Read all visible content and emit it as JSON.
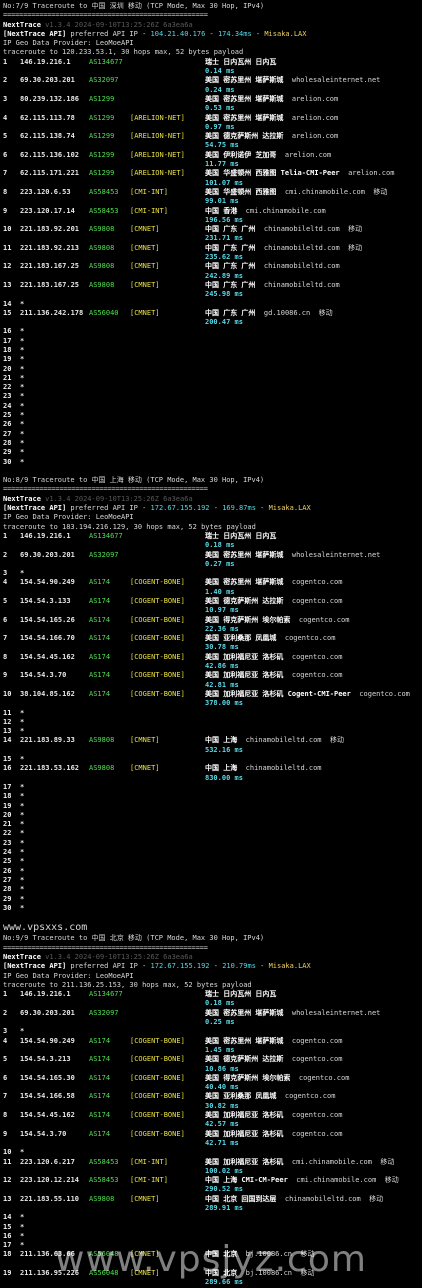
{
  "sections": [
    {
      "title": "No:7/9 Traceroute to 中国 深圳 移动 (TCP Mode, Max 30 Hop, IPv4)",
      "separator": "===================================================",
      "tool": "NextTrace",
      "version": "v1.3.4 2024-09-10T13:25:26Z 6a3ea6a",
      "api_label": "[NextTrace API]",
      "api_text": " preferred API IP - ",
      "api_ip": "104.21.40.176",
      "api_sep": " - ",
      "api_latency": "174.34ms",
      "api_sep2": " - ",
      "api_provider": "Misaka.LAX",
      "geo_line": "IP Geo Data Provider: LeoMoeAPI",
      "trace_line": "traceroute to 120.233.53.1, 30 hops max, 52 bytes payload",
      "hops": [
        {
          "n": "1",
          "ip": "146.19.216.1",
          "as": "AS134677",
          "tag": "",
          "geo": "瑞士 日内瓦州 日内瓦",
          "domain": "",
          "isp": "",
          "rtt": "0.14 ms"
        },
        {
          "n": "2",
          "ip": "69.30.203.201",
          "as": "AS32097",
          "tag": "",
          "geo": "美国 密苏里州 堪萨斯城",
          "domain": "wholesaleinternet.net",
          "isp": "",
          "rtt": "0.24 ms"
        },
        {
          "n": "3",
          "ip": "80.239.132.186",
          "as": "AS1299",
          "tag": "",
          "geo": "美国 密苏里州 堪萨斯城",
          "domain": "arelion.com",
          "isp": "",
          "rtt": "0.53 ms"
        },
        {
          "n": "4",
          "ip": "62.115.113.78",
          "as": "AS1299",
          "tag": "[ARELION-NET]",
          "geo": "美国 密苏里州 堪萨斯城",
          "domain": "arelion.com",
          "isp": "",
          "rtt": "0.97 ms"
        },
        {
          "n": "5",
          "ip": "62.115.138.74",
          "as": "AS1299",
          "tag": "[ARELION-NET]",
          "geo": "美国 德克萨斯州 达拉斯",
          "domain": "arelion.com",
          "isp": "",
          "rtt": "54.75 ms"
        },
        {
          "n": "6",
          "ip": "62.115.136.102",
          "as": "AS1299",
          "tag": "[ARELION-NET]",
          "geo": "美国 伊利诺伊 芝加哥",
          "domain": "arelion.com",
          "isp": "",
          "rtt": "11.77 ms"
        },
        {
          "n": "7",
          "ip": "62.115.171.221",
          "as": "AS1299",
          "tag": "[ARELION-NET]",
          "geo": "美国 华盛顿州 西雅图 Telia-CMI-Peer",
          "domain": "arelion.com",
          "isp": "",
          "rtt": "101.07 ms"
        },
        {
          "n": "8",
          "ip": "223.120.6.53",
          "as": "AS58453",
          "tag": "[CMI-INT]",
          "geo": "美国 华盛顿州 西雅图",
          "domain": "cmi.chinamobile.com",
          "isp": "移动",
          "rtt": "99.01 ms"
        },
        {
          "n": "9",
          "ip": "223.120.17.14",
          "as": "AS58453",
          "tag": "[CMI-INT]",
          "geo": "中国 香港",
          "domain": "cmi.chinamobile.com",
          "isp": "",
          "rtt": "196.56 ms"
        },
        {
          "n": "10",
          "ip": "221.183.92.201",
          "as": "AS9808",
          "tag": "[CMNET]",
          "geo": "中国 广东 广州",
          "domain": "chinamobileltd.com",
          "isp": "移动",
          "rtt": "231.71 ms"
        },
        {
          "n": "11",
          "ip": "221.183.92.213",
          "as": "AS9808",
          "tag": "[CMNET]",
          "geo": "中国 广东 广州",
          "domain": "chinamobileltd.com",
          "isp": "移动",
          "rtt": "235.62 ms"
        },
        {
          "n": "12",
          "ip": "221.183.167.25",
          "as": "AS9808",
          "tag": "[CMNET]",
          "geo": "中国 广东 广州",
          "domain": "chinamobileltd.com",
          "isp": "",
          "rtt": "242.89 ms"
        },
        {
          "n": "13",
          "ip": "221.183.167.25",
          "as": "AS9808",
          "tag": "[CMNET]",
          "geo": "中国 广东 广州",
          "domain": "chinamobileltd.com",
          "isp": "",
          "rtt": "245.98 ms"
        },
        {
          "n": "14",
          "star": true
        },
        {
          "n": "15",
          "ip": "211.136.242.178",
          "as": "AS56040",
          "tag": "[CMNET]",
          "geo": "中国 广东 广州",
          "domain": "gd.10086.cn",
          "isp": "移动",
          "rtt": "200.47 ms"
        },
        {
          "n": "16",
          "star": true
        },
        {
          "n": "17",
          "star": true
        },
        {
          "n": "18",
          "star": true
        },
        {
          "n": "19",
          "star": true
        },
        {
          "n": "20",
          "star": true
        },
        {
          "n": "21",
          "star": true
        },
        {
          "n": "22",
          "star": true
        },
        {
          "n": "23",
          "star": true
        },
        {
          "n": "24",
          "star": true
        },
        {
          "n": "25",
          "star": true
        },
        {
          "n": "26",
          "star": true
        },
        {
          "n": "27",
          "star": true
        },
        {
          "n": "28",
          "star": true
        },
        {
          "n": "29",
          "star": true
        },
        {
          "n": "30",
          "star": true
        }
      ]
    },
    {
      "title": "No:8/9 Traceroute to 中国 上海 移动 (TCP Mode, Max 30 Hop, IPv4)",
      "separator": "===================================================",
      "tool": "NextTrace",
      "version": "v1.3.4 2024-09-10T13:25:26Z 6a3ea6a",
      "api_label": "[NextTrace API]",
      "api_text": " preferred API IP - ",
      "api_ip": "172.67.155.192",
      "api_sep": " - ",
      "api_latency": "169.87ms",
      "api_sep2": " - ",
      "api_provider": "Misaka.LAX",
      "geo_line": "IP Geo Data Provider: LeoMoeAPI",
      "trace_line": "traceroute to 183.194.216.129, 30 hops max, 52 bytes payload",
      "hops": [
        {
          "n": "1",
          "ip": "146.19.216.1",
          "as": "AS134677",
          "tag": "",
          "geo": "瑞士 日内瓦州 日内瓦",
          "domain": "",
          "isp": "",
          "rtt": "0.18 ms"
        },
        {
          "n": "2",
          "ip": "69.30.203.201",
          "as": "AS32097",
          "tag": "",
          "geo": "美国 密苏里州 堪萨斯城",
          "domain": "wholesaleinternet.net",
          "isp": "",
          "rtt": "0.27 ms"
        },
        {
          "n": "3",
          "star": true
        },
        {
          "n": "4",
          "ip": "154.54.90.249",
          "as": "AS174",
          "tag": "[COGENT-BONE]",
          "geo": "美国 密苏里州 堪萨斯城",
          "domain": "cogentco.com",
          "isp": "",
          "rtt": "1.40 ms"
        },
        {
          "n": "5",
          "ip": "154.54.3.133",
          "as": "AS174",
          "tag": "[COGENT-BONE]",
          "geo": "美国 德克萨斯州 达拉斯",
          "domain": "cogentco.com",
          "isp": "",
          "rtt": "10.97 ms"
        },
        {
          "n": "6",
          "ip": "154.54.165.26",
          "as": "AS174",
          "tag": "[COGENT-BONE]",
          "geo": "美国 得克萨斯州 埃尔帕索",
          "domain": "cogentco.com",
          "isp": "",
          "rtt": "22.36 ms"
        },
        {
          "n": "7",
          "ip": "154.54.166.70",
          "as": "AS174",
          "tag": "[COGENT-BONE]",
          "geo": "美国 亚利桑那 凤凰城",
          "domain": "cogentco.com",
          "isp": "",
          "rtt": "30.78 ms"
        },
        {
          "n": "8",
          "ip": "154.54.45.162",
          "as": "AS174",
          "tag": "[COGENT-BONE]",
          "geo": "美国 加利福尼亚 洛杉矶",
          "domain": "cogentco.com",
          "isp": "",
          "rtt": "42.86 ms"
        },
        {
          "n": "9",
          "ip": "154.54.3.70",
          "as": "AS174",
          "tag": "[COGENT-BONE]",
          "geo": "美国 加利福尼亚 洛杉矶",
          "domain": "cogentco.com",
          "isp": "",
          "rtt": "42.81 ms"
        },
        {
          "n": "10",
          "ip": "38.104.85.162",
          "as": "AS174",
          "tag": "[COGENT-BONE]",
          "geo": "美国 加利福尼亚 洛杉矶 Cogent-CMI-Peer",
          "domain": "cogentco.com",
          "isp": "",
          "rtt": "378.00 ms"
        },
        {
          "n": "11",
          "star": true
        },
        {
          "n": "12",
          "star": true
        },
        {
          "n": "13",
          "star": true
        },
        {
          "n": "14",
          "ip": "221.183.89.33",
          "as": "AS9808",
          "tag": "[CMNET]",
          "geo": "中国 上海",
          "domain": "chinamobileltd.com",
          "isp": "移动",
          "rtt": "532.16 ms"
        },
        {
          "n": "15",
          "star": true
        },
        {
          "n": "16",
          "ip": "221.183.53.162",
          "as": "AS9808",
          "tag": "[CMNET]",
          "geo": "中国 上海",
          "domain": "chinamobileltd.com",
          "isp": "",
          "rtt": "830.00 ms"
        },
        {
          "n": "17",
          "star": true
        },
        {
          "n": "18",
          "star": true
        },
        {
          "n": "19",
          "star": true
        },
        {
          "n": "20",
          "star": true
        },
        {
          "n": "21",
          "star": true
        },
        {
          "n": "22",
          "star": true
        },
        {
          "n": "23",
          "star": true
        },
        {
          "n": "24",
          "star": true
        },
        {
          "n": "25",
          "star": true
        },
        {
          "n": "26",
          "star": true
        },
        {
          "n": "27",
          "star": true
        },
        {
          "n": "28",
          "star": true
        },
        {
          "n": "29",
          "star": true
        },
        {
          "n": "30",
          "star": true
        }
      ]
    },
    {
      "watermark_small": "www.vpsxxs.com",
      "title": "No:9/9 Traceroute to 中国 北京 移动 (TCP Mode, Max 30 Hop, IPv4)",
      "separator": "===================================================",
      "tool": "NextTrace",
      "version": "v1.3.4 2024-09-10T13:25:26Z 6a3ea6a",
      "api_label": "[NextTrace API]",
      "api_text": " preferred API IP - ",
      "api_ip": "172.67.155.192",
      "api_sep": " - ",
      "api_latency": "210.79ms",
      "api_sep2": " - ",
      "api_provider": "Misaka.LAX",
      "geo_line": "IP Geo Data Provider: LeoMoeAPI",
      "trace_line": "traceroute to 211.136.25.153, 30 hops max, 52 bytes payload",
      "hops": [
        {
          "n": "1",
          "ip": "146.19.216.1",
          "as": "AS134677",
          "tag": "",
          "geo": "瑞士 日内瓦州 日内瓦",
          "domain": "",
          "isp": "",
          "rtt": "0.18 ms"
        },
        {
          "n": "2",
          "ip": "69.30.203.201",
          "as": "AS32097",
          "tag": "",
          "geo": "美国 密苏里州 堪萨斯城",
          "domain": "wholesaleinternet.net",
          "isp": "",
          "rtt": "0.25 ms"
        },
        {
          "n": "3",
          "star": true
        },
        {
          "n": "4",
          "ip": "154.54.90.249",
          "as": "AS174",
          "tag": "[COGENT-BONE]",
          "geo": "美国 密苏里州 堪萨斯城",
          "domain": "cogentco.com",
          "isp": "",
          "rtt": "1.45 ms"
        },
        {
          "n": "5",
          "ip": "154.54.3.213",
          "as": "AS174",
          "tag": "[COGENT-BONE]",
          "geo": "美国 德克萨斯州 达拉斯",
          "domain": "cogentco.com",
          "isp": "",
          "rtt": "10.86 ms"
        },
        {
          "n": "6",
          "ip": "154.54.165.30",
          "as": "AS174",
          "tag": "[COGENT-BONE]",
          "geo": "美国 得克萨斯州 埃尔帕索",
          "domain": "cogentco.com",
          "isp": "",
          "rtt": "40.40 ms"
        },
        {
          "n": "7",
          "ip": "154.54.166.58",
          "as": "AS174",
          "tag": "[COGENT-BONE]",
          "geo": "美国 亚利桑那 凤凰城",
          "domain": "cogentco.com",
          "isp": "",
          "rtt": "30.82 ms"
        },
        {
          "n": "8",
          "ip": "154.54.45.162",
          "as": "AS174",
          "tag": "[COGENT-BONE]",
          "geo": "美国 加利福尼亚 洛杉矶",
          "domain": "cogentco.com",
          "isp": "",
          "rtt": "42.57 ms"
        },
        {
          "n": "9",
          "ip": "154.54.3.70",
          "as": "AS174",
          "tag": "[COGENT-BONE]",
          "geo": "美国 加利福尼亚 洛杉矶",
          "domain": "cogentco.com",
          "isp": "",
          "rtt": "42.71 ms"
        },
        {
          "n": "10",
          "star": true
        },
        {
          "n": "11",
          "ip": "223.120.6.217",
          "as": "AS58453",
          "tag": "[CMI-INT]",
          "geo": "美国 加利福尼亚 洛杉矶",
          "domain": "cmi.chinamobile.com",
          "isp": "移动",
          "rtt": "100.02 ms"
        },
        {
          "n": "12",
          "ip": "223.120.12.214",
          "as": "AS58453",
          "tag": "[CMI-INT]",
          "geo": "中国 上海 CMI-CM-Peer",
          "domain": "cmi.chinamobile.com",
          "isp": "移动",
          "rtt": "290.52 ms"
        },
        {
          "n": "13",
          "ip": "221.183.55.110",
          "as": "AS9808",
          "tag": "[CMNET]",
          "geo": "中国 北京 回国到达层",
          "domain": "chinamobileltd.com",
          "isp": "移动",
          "rtt": "289.91 ms"
        },
        {
          "n": "14",
          "star": true
        },
        {
          "n": "15",
          "star": true
        },
        {
          "n": "16",
          "star": true
        },
        {
          "n": "17",
          "star": true
        },
        {
          "n": "18",
          "ip": "211.136.63.66",
          "as": "AS56048",
          "tag": "[CMNET]",
          "geo": "中国 北京",
          "domain": "bj.10086.cn",
          "isp": "移动",
          "rtt": ""
        },
        {
          "n": "19",
          "ip": "211.136.95.226",
          "as": "AS56048",
          "tag": "[CMNET]",
          "geo": "中国 北京",
          "domain": "bj.10086.cn",
          "isp": "移动",
          "rtt": "289.66 ms"
        }
      ]
    }
  ],
  "watermark_big": "www.vpsjyz.com"
}
